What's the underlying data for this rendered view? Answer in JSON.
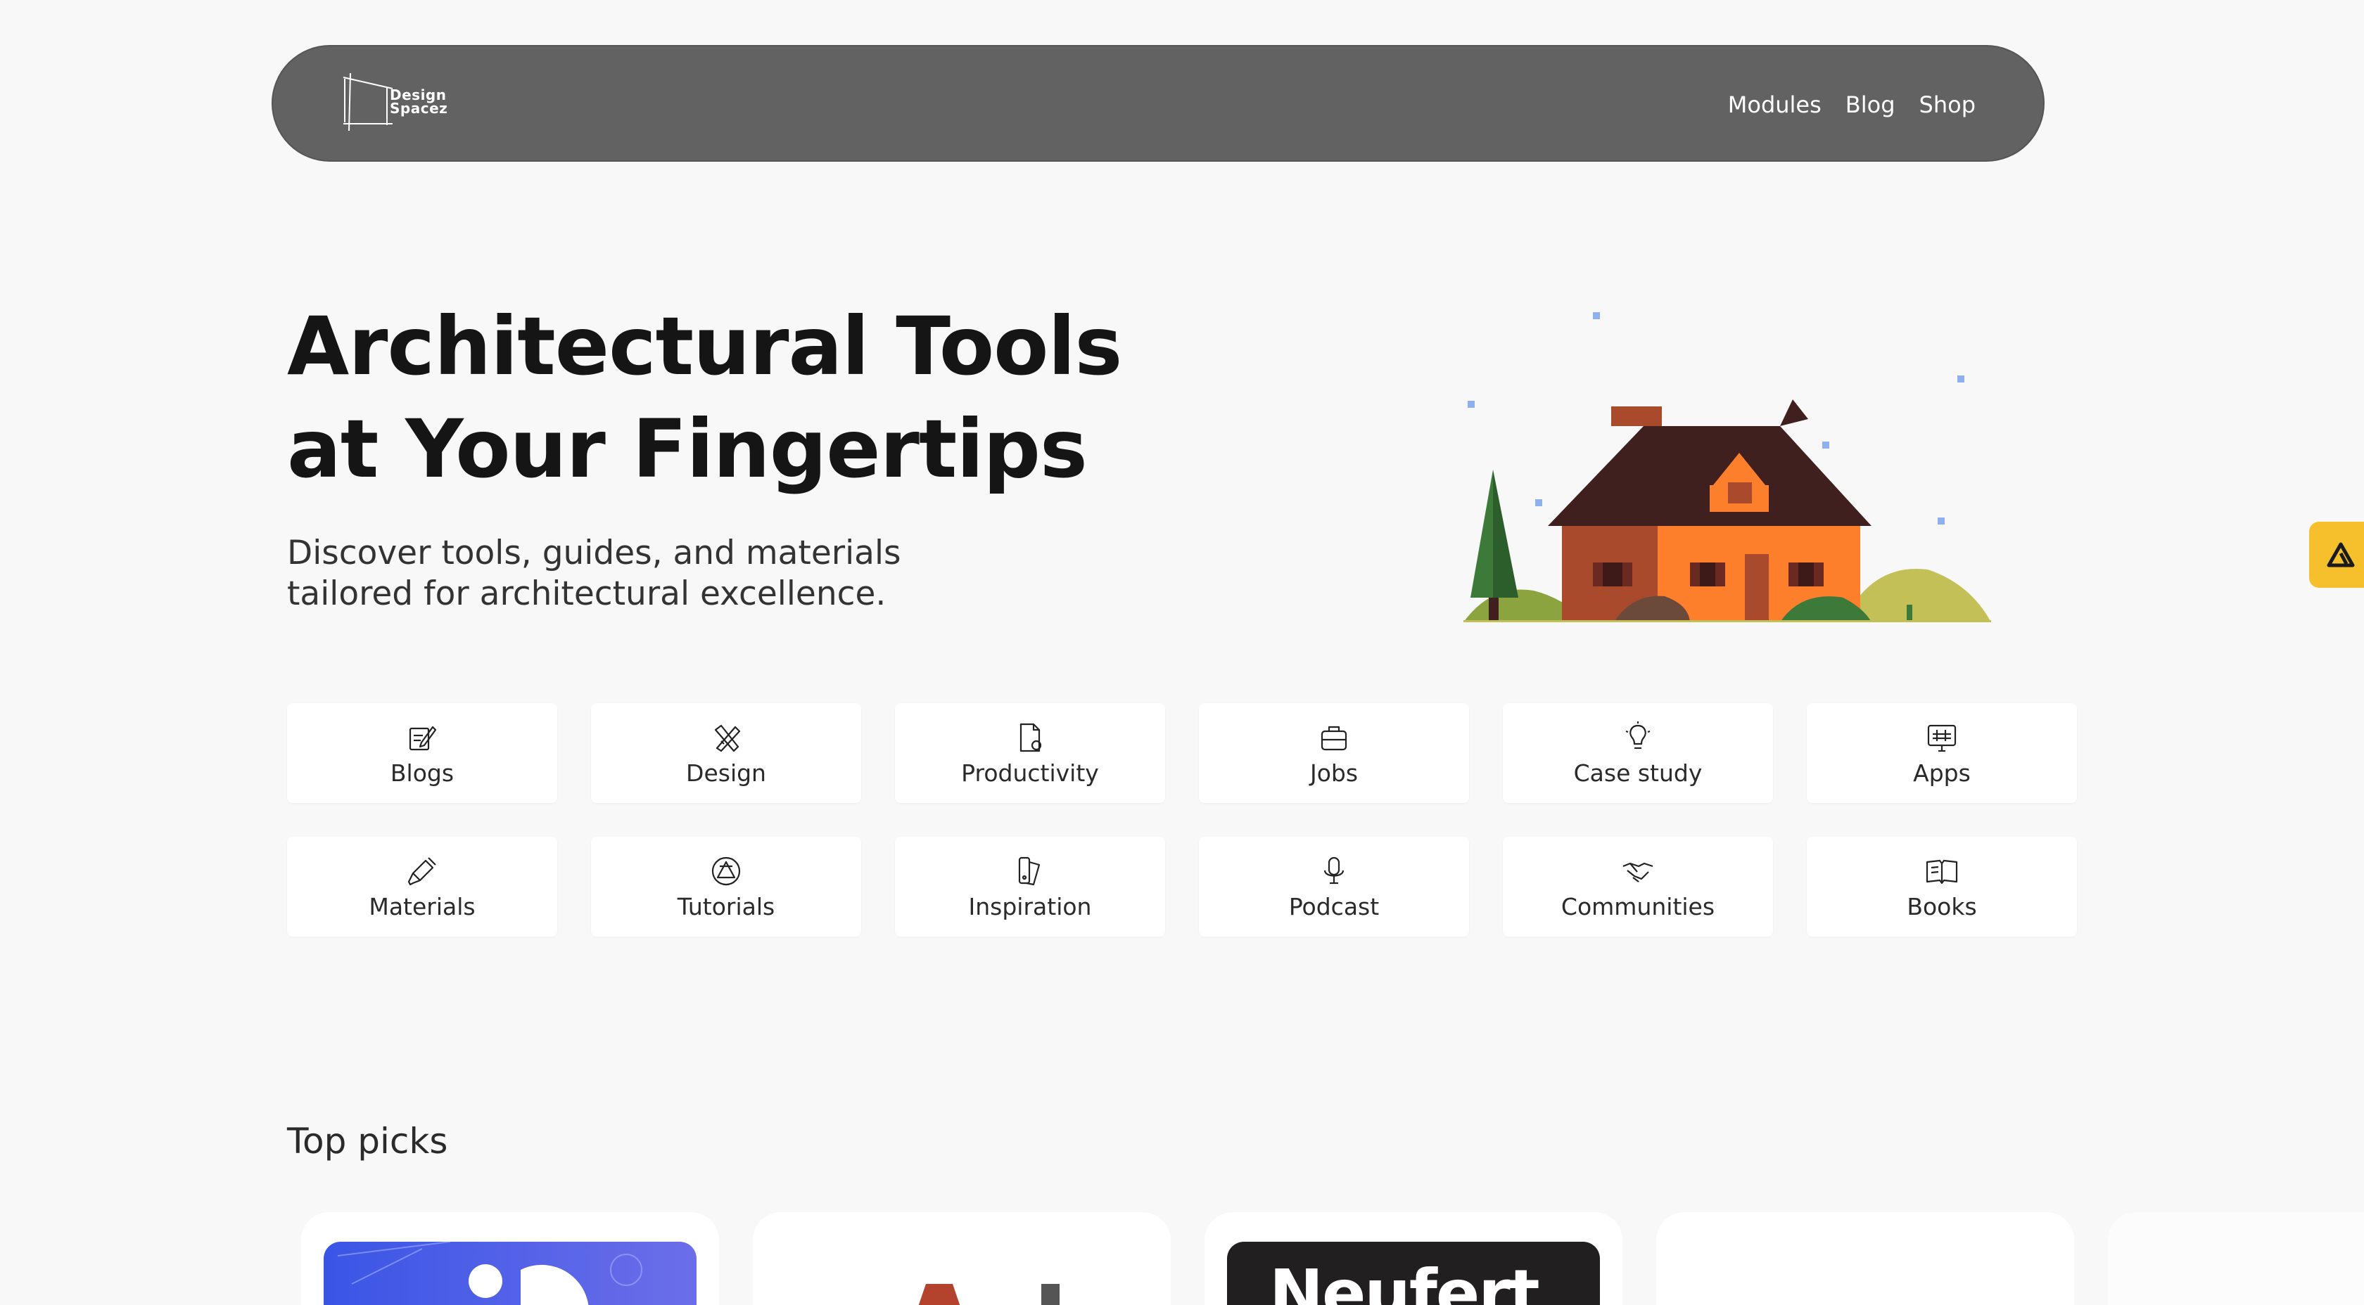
{
  "nav": {
    "logo_text": [
      "Design",
      "Spacez"
    ],
    "links": [
      "Modules",
      "Blog",
      "Shop"
    ]
  },
  "hero": {
    "title_line1": "Architectural Tools",
    "title_line2": "at Your Fingertips",
    "subtitle_line1": "Discover tools, guides, and materials",
    "subtitle_line2": "tailored for architectural excellence."
  },
  "categories": [
    {
      "label": "Blogs",
      "icon": "edit-note-icon"
    },
    {
      "label": "Design",
      "icon": "design-tools-icon"
    },
    {
      "label": "Productivity",
      "icon": "document-clip-icon"
    },
    {
      "label": "Jobs",
      "icon": "briefcase-icon"
    },
    {
      "label": "Case study",
      "icon": "lightbulb-icon"
    },
    {
      "label": "Apps",
      "icon": "monitor-grid-icon"
    },
    {
      "label": "Materials",
      "icon": "dropper-icon"
    },
    {
      "label": "Tutorials",
      "icon": "aperture-icon"
    },
    {
      "label": "Inspiration",
      "icon": "palette-swatch-icon"
    },
    {
      "label": "Podcast",
      "icon": "microphone-icon"
    },
    {
      "label": "Communities",
      "icon": "handshake-icon"
    },
    {
      "label": "Books",
      "icon": "open-book-icon"
    }
  ],
  "top_picks": {
    "title": "Top picks",
    "cards": [
      {
        "thumb_style": "blue-abstract"
      },
      {
        "thumb_style": "letter-graphic"
      },
      {
        "thumb_text": "Neufert"
      },
      {
        "thumb_style": "blank"
      }
    ]
  },
  "side_badge": {
    "icon": "triangle-logo-icon"
  },
  "colors": {
    "background": "#f8f8f8",
    "nav": "#626262",
    "badge": "#f6c02d",
    "house_wall": "#fd7f2c",
    "house_roof": "#40201f",
    "house_brick": "#a84a2b"
  }
}
